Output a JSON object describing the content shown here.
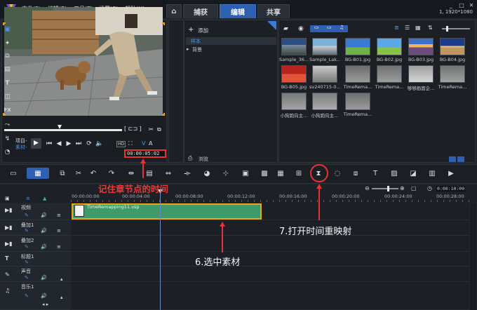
{
  "menu": {
    "items": [
      "文件(F)",
      "编辑(E)",
      "工具(T)",
      "设置(S)",
      "帮助(H)"
    ]
  },
  "workspace_tabs": {
    "capture": "捕获",
    "edit": "编辑",
    "share": "共享"
  },
  "window": {
    "resolution": "1, 1920*1080"
  },
  "library": {
    "add_label": "添加",
    "tree": {
      "sample": "样本",
      "background": "背景"
    },
    "browse_label": "浏览",
    "thumbnails": [
      "Sample_36...",
      "Sample_Lak...",
      "BG-B01.jpg",
      "BG-B02.jpg",
      "BG-B03.jpg",
      "BG-B04.jpg",
      "BG-B05.jpg",
      "sv240715-0...",
      "TimeRema...",
      "TimeRema...",
      "够够画面企...",
      "TimeRema...",
      "小狗跑向主...",
      "小狗跑向主...",
      "TimeRema..."
    ]
  },
  "preview": {
    "project_label": "项目-",
    "clip_label": "素材-",
    "timecode": "00:00:05:02",
    "quality_label": "HD"
  },
  "timeline": {
    "ruler_labels": [
      "00:00:00:00",
      "00:00:04:00",
      "00:00:08:00",
      "00:00:12:00",
      "00:00:16:00",
      "00:00:20:00",
      "00:00:24:00",
      "00:00:28:00"
    ],
    "zoom_time": "0:00:10:00",
    "tracks": {
      "video": "视频",
      "overlay1": "叠加1",
      "overlay2": "叠加2",
      "title1": "标题1",
      "voice": "声音",
      "music1": "音乐1"
    },
    "clip": {
      "title": "TimeRemapping11.vsp"
    }
  },
  "annotations": {
    "chapter": "记住章节点的时间",
    "select_clip": "6.选中素材",
    "remap": "7.打开时间重映射"
  },
  "colors": {
    "accent_blue": "#2f5fb0",
    "clip_green": "#3e9a68",
    "clip_border": "#f0a315",
    "annotation_red": "#e53333"
  }
}
